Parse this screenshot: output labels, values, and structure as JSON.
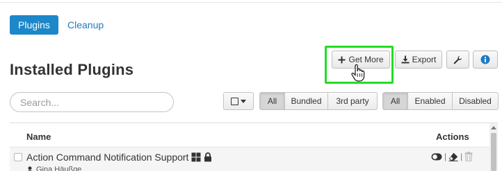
{
  "nav": {
    "tabs": [
      {
        "label": "Plugins",
        "active": true
      },
      {
        "label": "Cleanup",
        "active": false
      }
    ]
  },
  "page": {
    "title": "Installed Plugins"
  },
  "toolbar": {
    "get_more_label": "Get More",
    "export_label": "Export",
    "settings_icon": "wrench-icon",
    "info_icon": "info-icon"
  },
  "search": {
    "placeholder": "Search...",
    "value": ""
  },
  "filters": {
    "source": {
      "options": [
        "All",
        "Bundled",
        "3rd party"
      ],
      "selected": "All"
    },
    "status": {
      "options": [
        "All",
        "Enabled",
        "Disabled"
      ],
      "selected": "All"
    }
  },
  "table": {
    "columns": {
      "name": "Name",
      "actions": "Actions"
    },
    "rows": [
      {
        "title": "Action Command Notification Support",
        "author": "Gina Häußge",
        "icons": [
          "windows-icon",
          "lock-icon"
        ],
        "actions": [
          "toggle-icon",
          "eraser-icon",
          "trash-icon"
        ],
        "separator": "|"
      }
    ]
  },
  "colors": {
    "primary": "#1c87c9",
    "link": "#1c7bc0",
    "highlight": "#22dd22"
  }
}
